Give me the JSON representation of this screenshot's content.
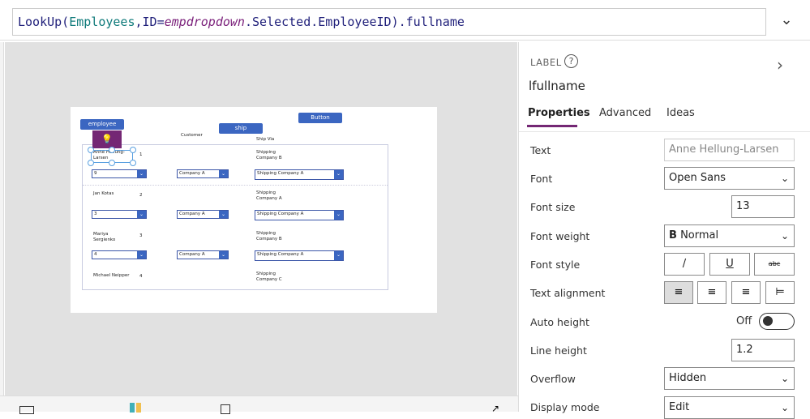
{
  "formula": {
    "fn": "LookUp(",
    "table": "Employees",
    "mid": ",ID=",
    "var": "empdropdown",
    "rest": ".Selected.EmployeeID).fullname"
  },
  "canvas": {
    "buttons": {
      "employee": "employee",
      "ship": "ship",
      "button": "Button"
    },
    "headers": {
      "customer": "Customer",
      "shipvia": "Ship Via"
    },
    "rows": [
      {
        "name": "Anne Hellung-Larsen",
        "id": "1",
        "ship": "Shipping Company B",
        "dd1": "9",
        "dd2": "Company A",
        "dd3": "Shipping Company A"
      },
      {
        "name": "Jan Kotas",
        "id": "2",
        "ship": "Shipping Company A",
        "dd1": "3",
        "dd2": "Company A",
        "dd3": "Shipping Company A"
      },
      {
        "name": "Mariya Sergienko",
        "id": "3",
        "ship": "Shipping Company B",
        "dd1": "4",
        "dd2": "Company A",
        "dd3": "Shipping Company A"
      },
      {
        "name": "Michael Neipper",
        "id": "4",
        "ship": "Shipping Company C"
      }
    ],
    "accent": "#3b66c1",
    "lightbulb_color": "#742774"
  },
  "panel": {
    "type": "LABEL",
    "name": "lfullname",
    "tabs": [
      "Properties",
      "Advanced",
      "Ideas"
    ],
    "props": {
      "text_label": "Text",
      "text_value": "Anne Hellung-Larsen",
      "font_label": "Font",
      "font_value": "Open Sans",
      "fontsize_label": "Font size",
      "fontsize_value": "13",
      "fontweight_label": "Font weight",
      "fontweight_value": "Normal",
      "fontweight_icon": "B",
      "fontstyle_label": "Font style",
      "italic": "/",
      "underline": "U",
      "strike": "abc",
      "align_label": "Text alignment",
      "autoheight_label": "Auto height",
      "autoheight_value": "Off",
      "lineheight_label": "Line height",
      "lineheight_value": "1.2",
      "overflow_label": "Overflow",
      "overflow_value": "Hidden",
      "displaymode_label": "Display mode",
      "displaymode_value": "Edit"
    }
  }
}
